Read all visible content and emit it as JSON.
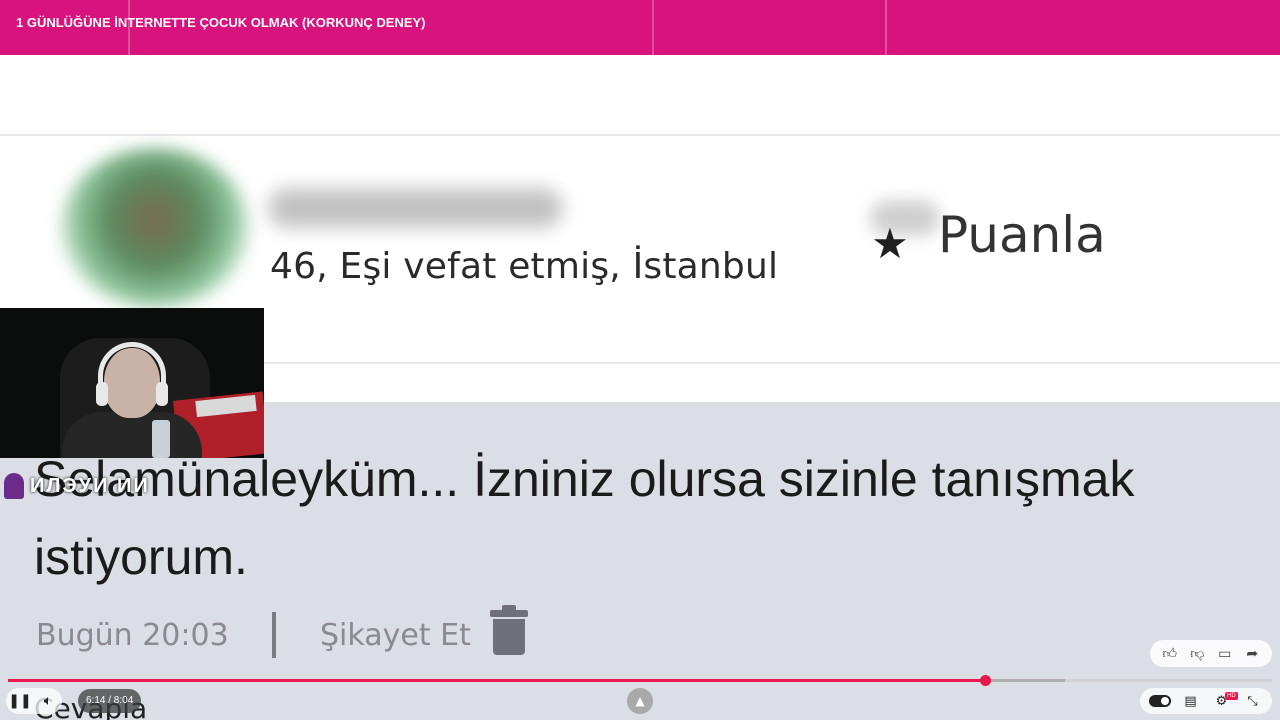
{
  "video": {
    "title": "1 GÜNLÜĞÜNE İNTERNETTE ÇOCUK OLMAK (KORKUNÇ DENEY)"
  },
  "profile": {
    "meta": "46, Eşi vefat etmiş, İstanbul",
    "rate_label": "Puanla",
    "rate_icon": "star-icon"
  },
  "message": {
    "text": "Selamünaleyküm... İzniniz olursa sizinle tanışmak istiyorum.",
    "time": "Bugün 20:03",
    "report_label": "Şikayet Et",
    "delete_icon": "trash-icon",
    "reply_label": "Cevapla"
  },
  "webcam": {
    "channel_name": "ИЛЭУИ ИИ"
  },
  "player": {
    "time_display": "6:14 / 8:04",
    "progress_fraction": 0.7727,
    "buffer_fraction": 0.836,
    "accent_color": "#e8174d",
    "hd_badge": "HD",
    "actions": [
      "like-icon",
      "dislike-icon",
      "comment-icon",
      "share-icon"
    ],
    "controls_left": [
      "pause-icon",
      "volume-icon"
    ],
    "controls_right": [
      "autoplay-toggle",
      "captions-icon",
      "settings-icon",
      "exit-fullscreen-icon"
    ]
  },
  "colors": {
    "topbar": "#d8137e",
    "message_panel": "#dcdee6"
  }
}
